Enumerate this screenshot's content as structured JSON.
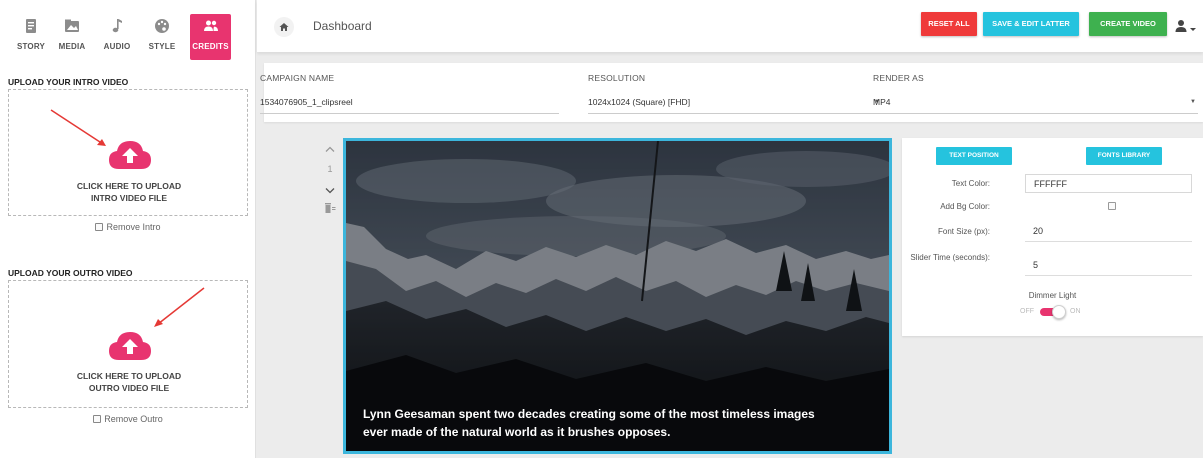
{
  "sidebar": {
    "tabs": [
      {
        "label": "STORY",
        "icon": "document-icon"
      },
      {
        "label": "MEDIA",
        "icon": "media-icon"
      },
      {
        "label": "AUDIO",
        "icon": "music-note-icon"
      },
      {
        "label": "STYLE",
        "icon": "palette-icon"
      },
      {
        "label": "CREDITS",
        "icon": "people-icon",
        "active": true
      }
    ],
    "intro": {
      "title": "UPLOAD YOUR INTRO VIDEO",
      "upload_line1": "CLICK HERE TO UPLOAD",
      "upload_line2": "INTRO VIDEO FILE",
      "remove_label": "Remove Intro"
    },
    "outro": {
      "title": "UPLOAD YOUR OUTRO VIDEO",
      "upload_line1": "CLICK HERE TO UPLOAD",
      "upload_line2": "OUTRO VIDEO FILE",
      "remove_label": "Remove Outro"
    }
  },
  "topbar": {
    "breadcrumb": "Dashboard",
    "reset_label": "RESET ALL",
    "save_label": "SAVE & EDIT LATTER",
    "create_label": "CREATE VIDEO"
  },
  "campaign": {
    "name_label": "CAMPAIGN NAME",
    "name_value": "1534076905_1_clipsreel",
    "resolution_label": "RESOLUTION",
    "resolution_value": "1024x1024 (Square) [FHD]",
    "render_label": "RENDER AS",
    "render_value": "MP4"
  },
  "slide": {
    "index": "1"
  },
  "video": {
    "caption_line1": "Lynn Geesaman spent two decades creating some of the most timeless images",
    "caption_line2": "ever made of the natural world as it brushes opposes."
  },
  "text_settings": {
    "position_button": "TEXT POSITION",
    "fonts_button": "FONTS LIBRARY",
    "text_color_label": "Text Color:",
    "text_color_value": "FFFFFF",
    "bg_color_label": "Add Bg Color:",
    "font_size_label": "Font Size (px):",
    "font_size_value": "20",
    "slider_time_label": "Slider Time (seconds):",
    "slider_time_value": "5",
    "dimmer_label": "Dimmer Light",
    "toggle_off": "OFF",
    "toggle_on": "ON"
  },
  "colors": {
    "accent_pink": "#e8346f",
    "reset_red": "#ef3a3a",
    "save_cyan": "#25c3de",
    "create_green": "#3eb14f",
    "video_border": "#3cb6dc"
  }
}
